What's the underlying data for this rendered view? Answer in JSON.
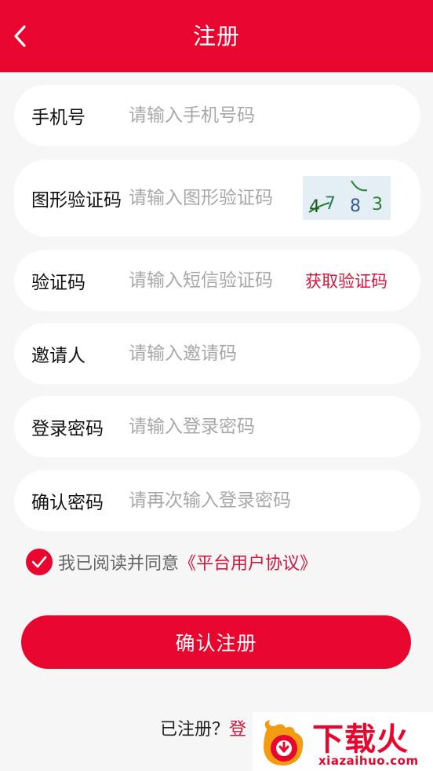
{
  "header": {
    "title": "注册",
    "back_icon": "chevron-left-icon"
  },
  "form": {
    "phone": {
      "label": "手机号",
      "placeholder": "请输入手机号码",
      "value": ""
    },
    "captcha": {
      "label": "图形验证码",
      "placeholder": "请输入图形验证码",
      "value": "",
      "image_text": "4783"
    },
    "sms": {
      "label": "验证码",
      "placeholder": "请输入短信验证码",
      "value": "",
      "get_code_label": "获取验证码"
    },
    "inviter": {
      "label": "邀请人",
      "placeholder": "请输入邀请码",
      "value": ""
    },
    "password": {
      "label": "登录密码",
      "placeholder": "请输入登录密码",
      "value": ""
    },
    "confirm_password": {
      "label": "确认密码",
      "placeholder": "请再次输入登录密码",
      "value": ""
    }
  },
  "agreement": {
    "checked": true,
    "text": "我已阅读并同意",
    "link": "《平台用户协议》"
  },
  "submit_label": "确认注册",
  "login_prompt": {
    "text": "已注册？",
    "link": "登"
  },
  "watermark": {
    "name": "下载火",
    "url": "xiazaihuo.com"
  },
  "colors": {
    "primary": "#e8062f",
    "link": "#d3163a",
    "background": "#f6f6f6",
    "placeholder": "#a8a8a8"
  }
}
